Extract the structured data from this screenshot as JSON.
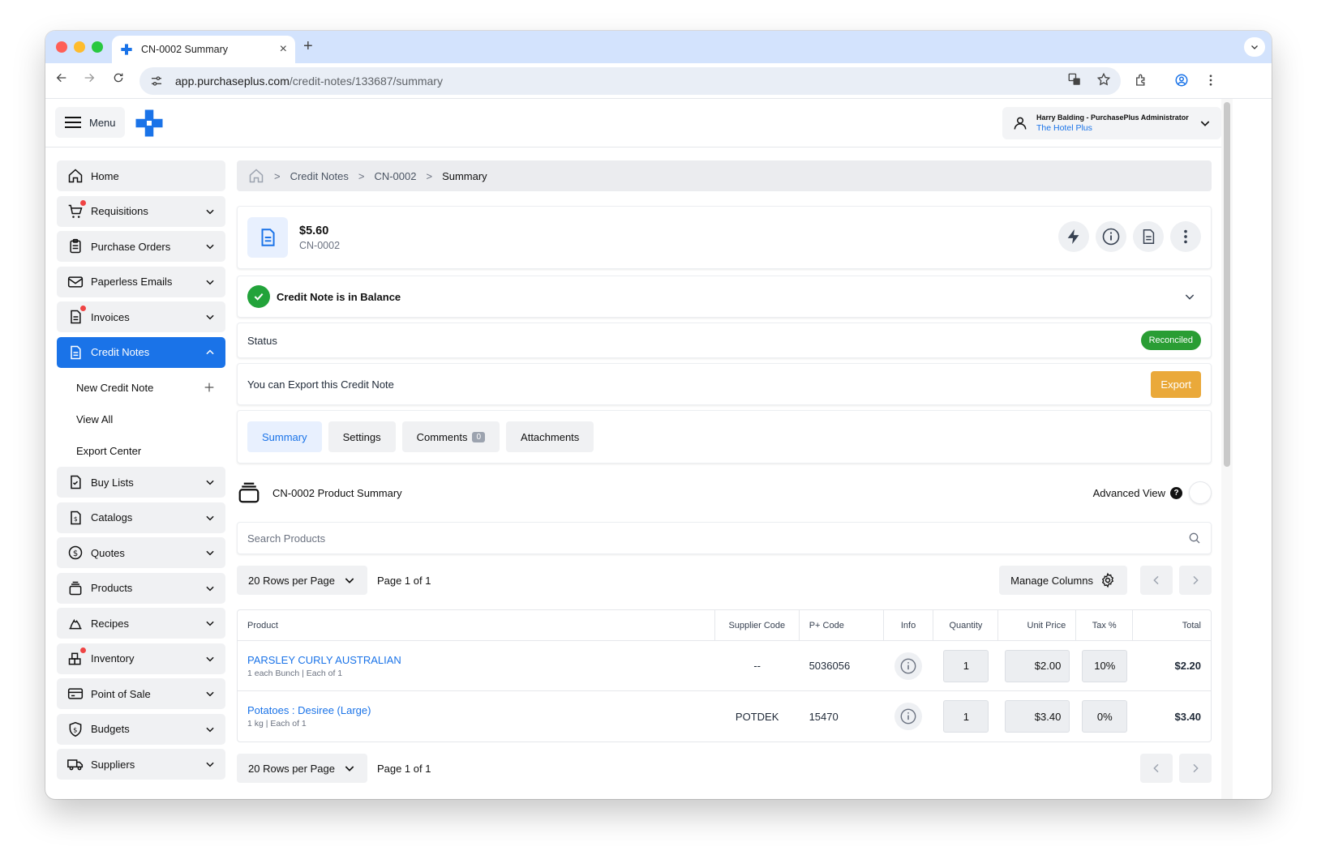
{
  "browser": {
    "tab_title": "CN-0002 Summary",
    "url_domain": "app.purchaseplus.com",
    "url_path": "/credit-notes/133687/summary"
  },
  "header": {
    "menu_label": "Menu",
    "user_name": "Harry Balding - PurchasePlus Administrator",
    "organisation": "The Hotel Plus"
  },
  "sidebar": {
    "items": [
      {
        "label": "Home",
        "icon": "home-icon"
      },
      {
        "label": "Requisitions",
        "icon": "cart-icon"
      },
      {
        "label": "Purchase Orders",
        "icon": "clipboard-icon"
      },
      {
        "label": "Paperless Emails",
        "icon": "mail-icon"
      },
      {
        "label": "Invoices",
        "icon": "invoice-icon"
      },
      {
        "label": "Credit Notes",
        "icon": "document-icon"
      },
      {
        "label": "Buy Lists",
        "icon": "checklist-icon"
      },
      {
        "label": "Catalogs",
        "icon": "catalog-icon"
      },
      {
        "label": "Quotes",
        "icon": "dollar-icon"
      },
      {
        "label": "Products",
        "icon": "products-icon"
      },
      {
        "label": "Recipes",
        "icon": "recipe-icon"
      },
      {
        "label": "Inventory",
        "icon": "inventory-icon"
      },
      {
        "label": "Point of Sale",
        "icon": "card-icon"
      },
      {
        "label": "Budgets",
        "icon": "shield-dollar-icon"
      },
      {
        "label": "Suppliers",
        "icon": "truck-icon"
      }
    ],
    "sub_items": [
      {
        "label": "New Credit Note"
      },
      {
        "label": "View All"
      },
      {
        "label": "Export Center"
      }
    ]
  },
  "breadcrumb": {
    "items": [
      "Credit Notes",
      "CN-0002"
    ],
    "current": "Summary"
  },
  "summary": {
    "amount": "$5.60",
    "number": "CN-0002"
  },
  "balance": {
    "message": "Credit Note is in Balance"
  },
  "status": {
    "label": "Status",
    "badge": "Reconciled",
    "badge_color": "#2a9d34"
  },
  "export": {
    "message": "You can Export this Credit Note",
    "button": "Export",
    "button_color": "#eaa93a"
  },
  "tabs": [
    {
      "label": "Summary"
    },
    {
      "label": "Settings"
    },
    {
      "label": "Comments",
      "count": "0"
    },
    {
      "label": "Attachments"
    }
  ],
  "product_summary": {
    "title": "CN-0002 Product Summary",
    "advanced_view": "Advanced View",
    "search_placeholder": "Search Products"
  },
  "pager": {
    "rows_per_page": "20 Rows per Page",
    "page_label": "Page 1 of 1",
    "manage_columns": "Manage Columns"
  },
  "table": {
    "columns": [
      "Product",
      "Supplier Code",
      "P+ Code",
      "Info",
      "Quantity",
      "Unit Price",
      "Tax %",
      "Total"
    ],
    "rows": [
      {
        "name": "PARSLEY CURLY AUSTRALIAN",
        "meta": "1 each Bunch | Each of 1",
        "supplier_code": "--",
        "p_code": "5036056",
        "quantity": "1",
        "unit_price": "$2.00",
        "tax": "10%",
        "total": "$2.20"
      },
      {
        "name": "Potatoes : Desiree (Large)",
        "meta": "1 kg | Each of 1",
        "supplier_code": "POTDEK",
        "p_code": "15470",
        "quantity": "1",
        "unit_price": "$3.40",
        "tax": "0%",
        "total": "$3.40"
      }
    ]
  },
  "colors": {
    "accent": "#1a73e8",
    "success": "#22a33a"
  }
}
